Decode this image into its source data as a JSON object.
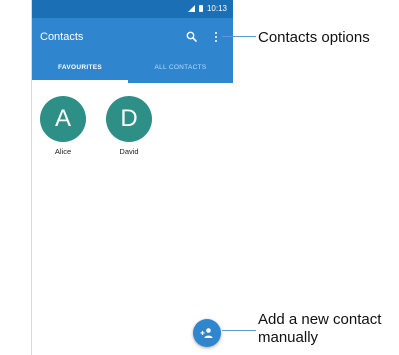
{
  "status_bar": {
    "time": "10:13"
  },
  "app_bar": {
    "title": "Contacts",
    "icons": [
      "search-icon",
      "more-vert-icon"
    ]
  },
  "tabs": [
    {
      "label": "FAVOURITES",
      "selected": true
    },
    {
      "label": "ALL CONTACTS",
      "selected": false
    }
  ],
  "favourites": [
    {
      "initial": "A",
      "name": "Alice"
    },
    {
      "initial": "D",
      "name": "David"
    }
  ],
  "fab": {
    "icon": "add-person-icon"
  },
  "annotations": {
    "options": "Contacts options",
    "add": "Add a new contact manually"
  },
  "colors": {
    "status_bar": "#1b6fb5",
    "app_bar": "#2f86cf",
    "avatar": "#2e8f86",
    "callout_line": "#5b9bd5"
  }
}
